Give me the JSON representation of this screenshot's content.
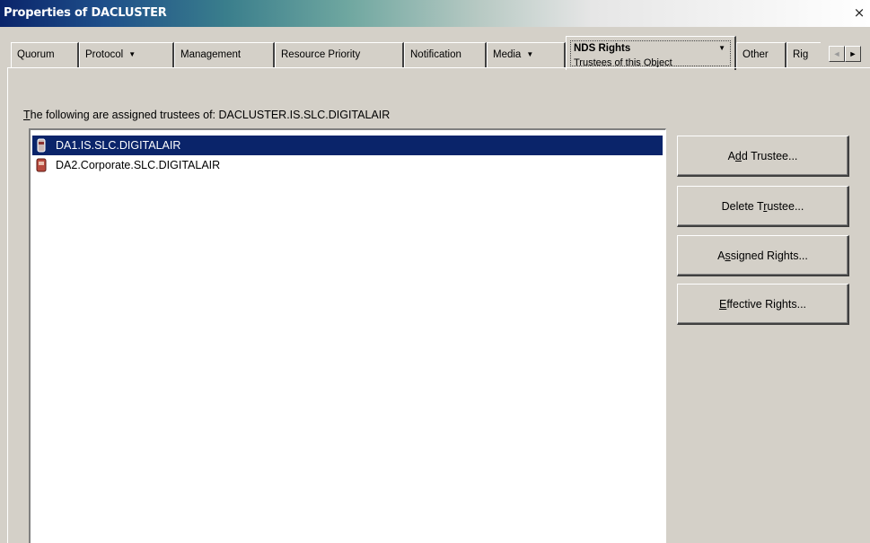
{
  "window": {
    "title": "Properties of DACLUSTER",
    "close_label": "×"
  },
  "tabs": [
    {
      "label": "Quorum"
    },
    {
      "label": "Protocol"
    },
    {
      "label": "Management"
    },
    {
      "label": "Resource Priority"
    },
    {
      "label": "Notification"
    },
    {
      "label": "Media"
    },
    {
      "label": "NDS Rights",
      "sub_label": "Trustees of this Object",
      "active": true
    },
    {
      "label": "Other"
    },
    {
      "label": "Rig"
    }
  ],
  "icons": {
    "dropdown": "▼",
    "scroll_left": "◄",
    "scroll_right": "►"
  },
  "instruction": {
    "prefix": "he following are assigned trustees of: DACLUSTER.IS.SLC.DIGITALAIR",
    "mnemonic": "T"
  },
  "trustees": [
    {
      "name": "DA1.IS.SLC.DIGITALAIR",
      "selected": true
    },
    {
      "name": "DA2.Corporate.SLC.DIGITALAIR",
      "selected": false
    }
  ],
  "buttons": {
    "add": {
      "pre": "A",
      "key": "d",
      "post": "d Trustee..."
    },
    "delete": {
      "pre": "Delete T",
      "key": "r",
      "post": "ustee..."
    },
    "assigned": {
      "pre": "A",
      "key": "s",
      "post": "signed Rights..."
    },
    "effective": {
      "pre": "",
      "key": "E",
      "post": "ffective Rights..."
    }
  },
  "colors": {
    "selection": "#0a246a",
    "title_start": "#0a246a",
    "face": "#d4d0c8"
  }
}
